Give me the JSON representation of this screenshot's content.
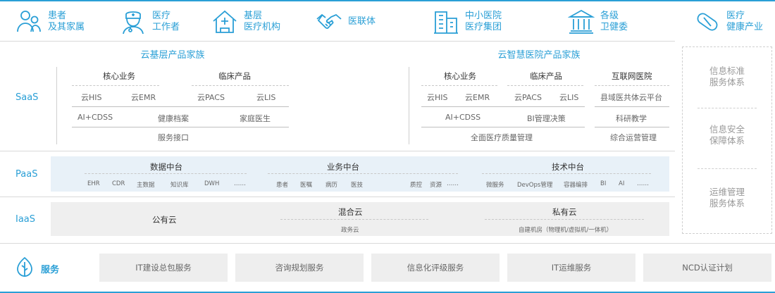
{
  "users": [
    {
      "icon": "family-icon",
      "label": "患者\n及其家属"
    },
    {
      "icon": "medical-worker-icon",
      "label": "医疗\n工作者"
    },
    {
      "icon": "clinic-building-icon",
      "label": "基层\n医疗机构"
    },
    {
      "icon": "handshake-icon",
      "label": "医联体"
    },
    {
      "icon": "hospital-building-icon",
      "label": "中小医院\n医疗集团"
    },
    {
      "icon": "government-building-icon",
      "label": "各级\n卫健委"
    },
    {
      "icon": "pill-icon",
      "label": "医疗\n健康产业"
    }
  ],
  "layers": {
    "saas": "SaaS",
    "paas": "PaaS",
    "iaas": "IaaS",
    "service": "服务"
  },
  "saas": {
    "grassroots": {
      "title": "云基层产品家族",
      "core": "核心业务",
      "clinical": "临床产品",
      "row1": [
        "云HIS",
        "云EMR",
        "云PACS",
        "云LIS"
      ],
      "row2": [
        "AI+CDSS",
        "健康档案",
        "家庭医生"
      ],
      "row3": "服务接口"
    },
    "smart": {
      "title": "云智慧医院产品家族",
      "core": "核心业务",
      "clinical": "临床产品",
      "internet": "互联网医院",
      "row1": [
        "云HIS",
        "云EMR",
        "云PACS",
        "云LIS",
        "县域医共体云平台"
      ],
      "row2": [
        "AI+CDSS",
        "BI管理决策",
        "科研教学"
      ],
      "row3": [
        "全面医疗质量管理",
        "综合运营管理"
      ]
    }
  },
  "paas": {
    "data": {
      "title": "数据中台",
      "items": [
        "EHR",
        "CDR",
        "主数据",
        "知识库",
        "DWH",
        "……"
      ]
    },
    "business": {
      "title": "业务中台",
      "items": [
        "患者",
        "医嘱",
        "病历",
        "医技",
        "质控",
        "资源",
        "……"
      ]
    },
    "tech": {
      "title": "技术中台",
      "items": [
        "微服务",
        "DevOps管理",
        "容器编排",
        "BI",
        "AI",
        "……"
      ]
    }
  },
  "iaas": {
    "public": "公有云",
    "hybrid": "混合云",
    "gov": "政务云",
    "private": "私有云",
    "private_sub": "自建机房（物理机/虚拟机/一体机）"
  },
  "side": [
    "信息标准\n服务体系",
    "信息安全\n保障体系",
    "运维管理\n服务体系"
  ],
  "services": [
    "IT建设总包服务",
    "咨询规划服务",
    "信息化评级服务",
    "IT运维服务",
    "NCD认证计划"
  ],
  "colors": {
    "accent": "#2a9fd6",
    "paas_band": "#e8f1f8",
    "iaas_band": "#efefef",
    "service_box": "#eeeeee"
  }
}
